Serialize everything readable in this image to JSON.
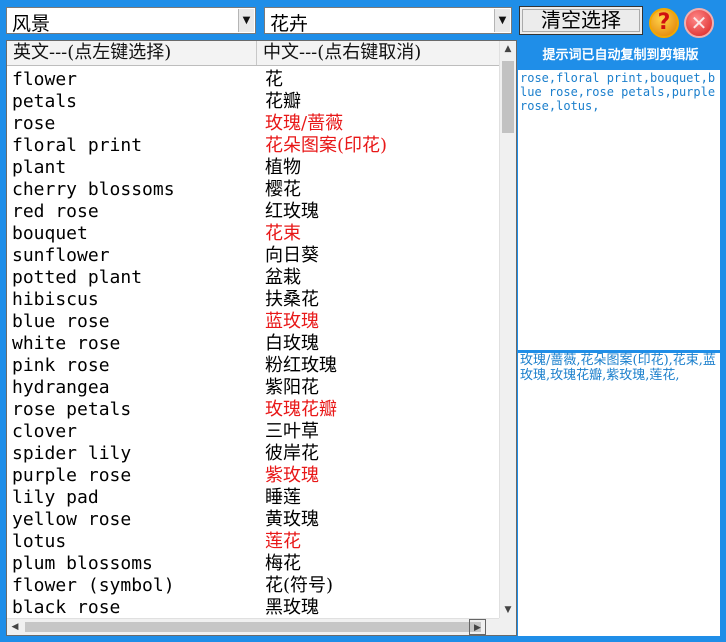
{
  "category_select": {
    "value": "风景"
  },
  "subcategory_select": {
    "value": "花卉"
  },
  "toolbar": {
    "clear_label": "清空选择",
    "help_glyph": "?",
    "close_glyph": "✕"
  },
  "list": {
    "col_en_header": "英文---(点左键选择)",
    "col_zh_header": "中文---(点右键取消)",
    "rows": [
      {
        "en": "flower",
        "zh": "花",
        "selected": false
      },
      {
        "en": "petals",
        "zh": "花瓣",
        "selected": false
      },
      {
        "en": "rose",
        "zh": "玫瑰/蔷薇",
        "selected": true
      },
      {
        "en": "floral print",
        "zh": "花朵图案(印花)",
        "selected": true
      },
      {
        "en": "plant",
        "zh": "植物",
        "selected": false
      },
      {
        "en": "cherry blossoms",
        "zh": "樱花",
        "selected": false
      },
      {
        "en": "red rose",
        "zh": "红玫瑰",
        "selected": false
      },
      {
        "en": "bouquet",
        "zh": "花束",
        "selected": true
      },
      {
        "en": "sunflower",
        "zh": "向日葵",
        "selected": false
      },
      {
        "en": "potted plant",
        "zh": "盆栽",
        "selected": false
      },
      {
        "en": "hibiscus",
        "zh": "扶桑花",
        "selected": false
      },
      {
        "en": "blue rose",
        "zh": "蓝玫瑰",
        "selected": true
      },
      {
        "en": "white rose",
        "zh": "白玫瑰",
        "selected": false
      },
      {
        "en": "pink rose",
        "zh": "粉红玫瑰",
        "selected": false
      },
      {
        "en": "hydrangea",
        "zh": "紫阳花",
        "selected": false
      },
      {
        "en": "rose petals",
        "zh": "玫瑰花瓣",
        "selected": true
      },
      {
        "en": "clover",
        "zh": "三叶草",
        "selected": false
      },
      {
        "en": "spider lily",
        "zh": "彼岸花",
        "selected": false
      },
      {
        "en": "purple rose",
        "zh": "紫玫瑰",
        "selected": true
      },
      {
        "en": "lily pad",
        "zh": "睡莲",
        "selected": false
      },
      {
        "en": "yellow rose",
        "zh": "黄玫瑰",
        "selected": false
      },
      {
        "en": "lotus",
        "zh": "莲花",
        "selected": true
      },
      {
        "en": "plum blossoms",
        "zh": "梅花",
        "selected": false
      },
      {
        "en": "flower (symbol)",
        "zh": "花(符号)",
        "selected": false
      },
      {
        "en": "black rose",
        "zh": "黑玫瑰",
        "selected": false
      }
    ]
  },
  "output": {
    "hint": "提示词已自动复制到剪辑版",
    "english_text": "rose,floral print,bouquet,blue rose,rose petals,purple rose,lotus,",
    "chinese_text": "玫瑰/蔷薇,花朵图案(印花),花束,蓝玫瑰,玫瑰花瓣,紫玫瑰,莲花,"
  },
  "colors": {
    "background": "#1f8ee8",
    "selected_text": "#e81818",
    "output_text": "#1b7fcc"
  }
}
